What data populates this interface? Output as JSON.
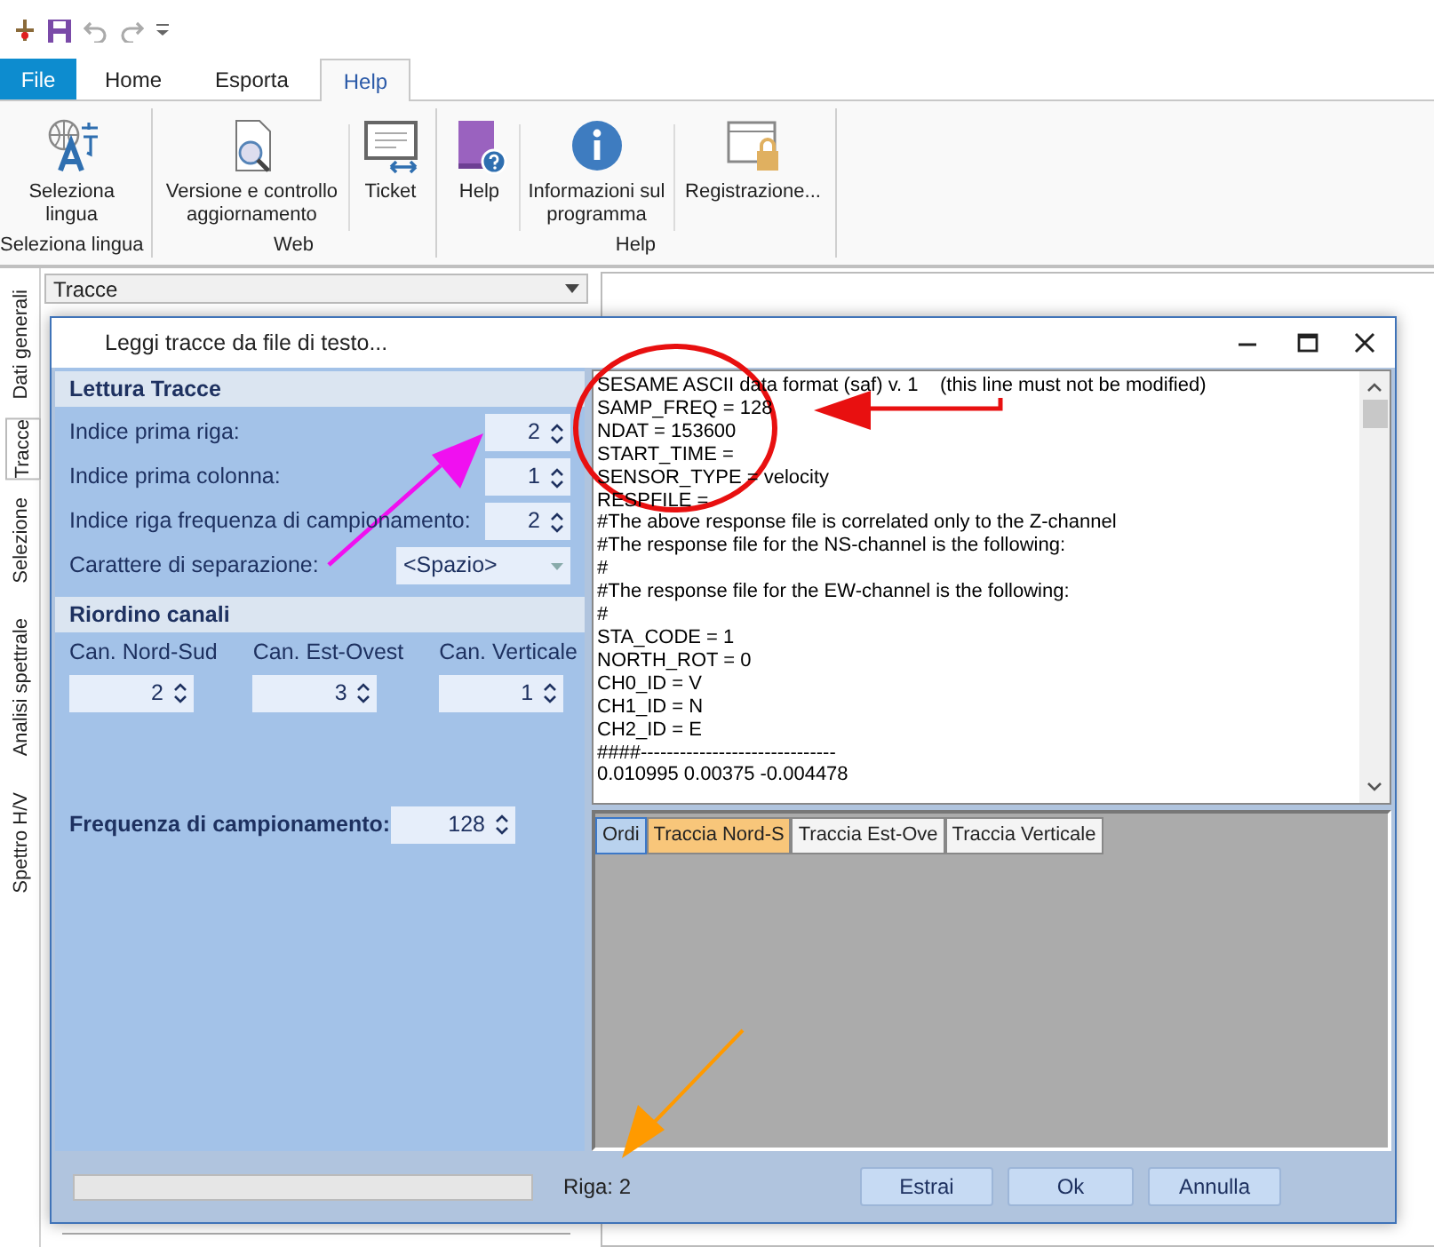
{
  "ribbon_tabs": [
    {
      "label": "File",
      "kind": "file",
      "selected": false
    },
    {
      "label": "Home",
      "kind": "tab",
      "selected": false
    },
    {
      "label": "Esporta",
      "kind": "tab",
      "selected": false
    },
    {
      "label": "Help",
      "kind": "tab",
      "selected": true
    }
  ],
  "ribbon_groups": [
    {
      "label": "Seleziona lingua",
      "buttons": [
        {
          "label": "Seleziona lingua",
          "kind": "language"
        }
      ]
    },
    {
      "label": "Web",
      "buttons": [
        {
          "label": "Versione e controllo aggiornamento",
          "kind": "update"
        },
        {
          "label": "Ticket",
          "kind": "ticket"
        }
      ]
    },
    {
      "label": "Help",
      "buttons": [
        {
          "label": "Help",
          "kind": "manual"
        },
        {
          "label": "Informazioni sul programma",
          "kind": "info"
        },
        {
          "label": "Registrazione...",
          "kind": "registration"
        }
      ]
    }
  ],
  "side_tabs": [
    {
      "label": "Dati generali",
      "selected": false
    },
    {
      "label": "Tracce",
      "selected": true
    },
    {
      "label": "Selezione",
      "selected": false
    },
    {
      "label": "Analisi spettrale",
      "selected": false
    },
    {
      "label": "Spettro H/V",
      "selected": false
    }
  ],
  "view_selector": {
    "value": "Tracce"
  },
  "dialog": {
    "title": "Leggi tracce da file di testo...",
    "reading_section": {
      "title": "Lettura Tracce",
      "fields": [
        {
          "label": "Indice prima riga:",
          "value": "2",
          "kind": "spinner"
        },
        {
          "label": "Indice prima colonna:",
          "value": "1",
          "kind": "spinner"
        },
        {
          "label": "Indice riga frequenza di campionamento:",
          "value": "2",
          "kind": "spinner"
        },
        {
          "label": "Carattere di separazione:",
          "value": "<Spazio>",
          "kind": "dropdown"
        }
      ]
    },
    "channels_section": {
      "title": "Riordino canali",
      "channels": [
        {
          "label": "Can. Nord-Sud",
          "value": "2"
        },
        {
          "label": "Can. Est-Ovest",
          "value": "3"
        },
        {
          "label": "Can. Verticale",
          "value": "1"
        }
      ]
    },
    "frequency": {
      "label": "Frequenza di campionamento:",
      "value": "128"
    },
    "file_preview": [
      "SESAME ASCII data format (saf) v. 1    (this line must not be modified)",
      "SAMP_FREQ = 128",
      "NDAT = 153600",
      "START_TIME =",
      "SENSOR_TYPE = velocity",
      "RESPFILE =",
      "#The above response file is correlated only to the Z-channel",
      "#The response file for the NS-channel is the following:",
      "#",
      "#The response file for the EW-channel is the following:",
      "#",
      "STA_CODE = 1",
      "NORTH_ROT = 0",
      "CH0_ID = V",
      "CH1_ID = N",
      "CH2_ID = E",
      "####------------------------------",
      "0.010995 0.00375 -0.004478"
    ],
    "trace_tabs": [
      {
        "label": "Ordi",
        "selected": false,
        "highlighted": true
      },
      {
        "label": "Traccia Nord-S",
        "selected": true,
        "highlighted": false
      },
      {
        "label": "Traccia Est-Ove",
        "selected": false,
        "highlighted": false
      },
      {
        "label": "Traccia Verticale",
        "selected": false,
        "highlighted": false
      }
    ],
    "progress": {
      "level": 0
    },
    "status": "Riga: 2",
    "buttons": [
      "Estrai",
      "Ok",
      "Annulla"
    ]
  }
}
